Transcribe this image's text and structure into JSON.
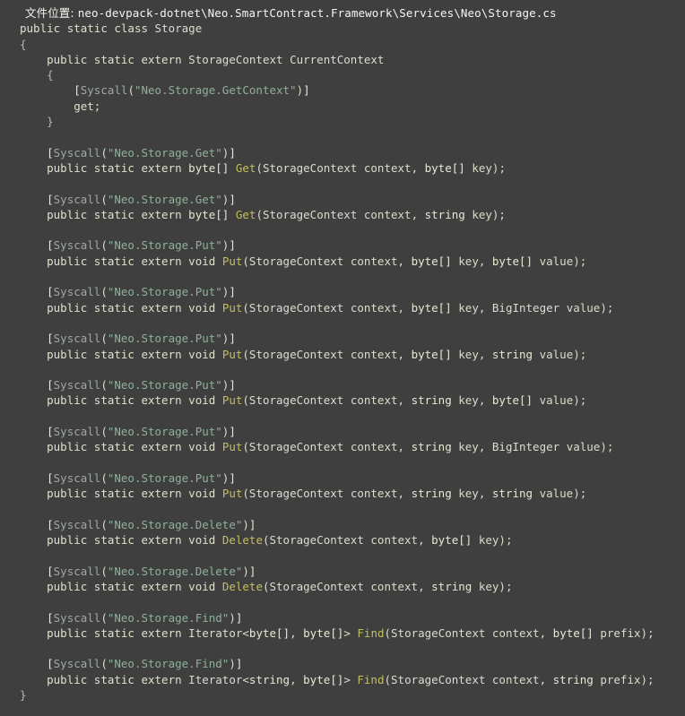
{
  "window": {
    "background_color": "#3f3f3f",
    "foreground_color": "#dcdccc"
  },
  "header": {
    "label": "文件位置:",
    "path": "neo-devpack-dotnet\\Neo.SmartContract.Framework\\Services\\Neo\\Storage.cs"
  },
  "colors": {
    "background": "#3f3f3f",
    "default_text": "#dcdccc",
    "keyword": "#e0e0cc",
    "type": "#dcdcd0",
    "method": "#c3bf5f",
    "string": "#8fb09a",
    "attribute_name": "#9fa8a3",
    "brace": "#b8b8a8",
    "header_text": "#f5f5f0"
  },
  "code": {
    "language": "csharp",
    "file_name": "Storage.cs",
    "class_name": "Storage",
    "line_count": 46,
    "lines": [
      "public static class Storage",
      "{",
      "    public static extern StorageContext CurrentContext",
      "    {",
      "        [Syscall(\"Neo.Storage.GetContext\")]",
      "        get;",
      "    }",
      "",
      "    [Syscall(\"Neo.Storage.Get\")]",
      "    public static extern byte[] Get(StorageContext context, byte[] key);",
      "",
      "    [Syscall(\"Neo.Storage.Get\")]",
      "    public static extern byte[] Get(StorageContext context, string key);",
      "",
      "    [Syscall(\"Neo.Storage.Put\")]",
      "    public static extern void Put(StorageContext context, byte[] key, byte[] value);",
      "",
      "    [Syscall(\"Neo.Storage.Put\")]",
      "    public static extern void Put(StorageContext context, byte[] key, BigInteger value);",
      "",
      "    [Syscall(\"Neo.Storage.Put\")]",
      "    public static extern void Put(StorageContext context, byte[] key, string value);",
      "",
      "    [Syscall(\"Neo.Storage.Put\")]",
      "    public static extern void Put(StorageContext context, string key, byte[] value);",
      "",
      "    [Syscall(\"Neo.Storage.Put\")]",
      "    public static extern void Put(StorageContext context, string key, BigInteger value);",
      "",
      "    [Syscall(\"Neo.Storage.Put\")]",
      "    public static extern void Put(StorageContext context, string key, string value);",
      "",
      "    [Syscall(\"Neo.Storage.Delete\")]",
      "    public static extern void Delete(StorageContext context, byte[] key);",
      "",
      "    [Syscall(\"Neo.Storage.Delete\")]",
      "    public static extern void Delete(StorageContext context, string key);",
      "",
      "    [Syscall(\"Neo.Storage.Find\")]",
      "    public static extern Iterator<byte[], byte[]> Find(StorageContext context, byte[] prefix);",
      "",
      "    [Syscall(\"Neo.Storage.Find\")]",
      "    public static extern Iterator<string, byte[]> Find(StorageContext context, string prefix);",
      "}"
    ],
    "syscalls": [
      "Neo.Storage.GetContext",
      "Neo.Storage.Get",
      "Neo.Storage.Get",
      "Neo.Storage.Put",
      "Neo.Storage.Put",
      "Neo.Storage.Put",
      "Neo.Storage.Put",
      "Neo.Storage.Put",
      "Neo.Storage.Put",
      "Neo.Storage.Delete",
      "Neo.Storage.Delete",
      "Neo.Storage.Find",
      "Neo.Storage.Find"
    ],
    "members": [
      "CurrentContext",
      "Get",
      "Get",
      "Put",
      "Put",
      "Put",
      "Put",
      "Put",
      "Put",
      "Delete",
      "Delete",
      "Find",
      "Find"
    ]
  }
}
